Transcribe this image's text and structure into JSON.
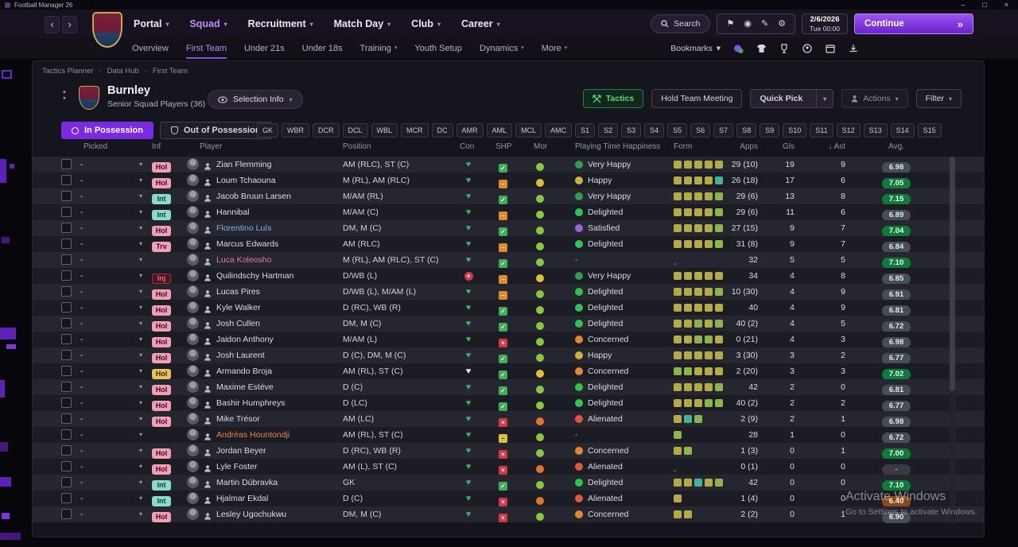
{
  "window": {
    "title": "Football Manager 26"
  },
  "icons": {
    "chevron_down": "▾",
    "back": "‹",
    "forward": "›",
    "continue_chevrons": "»",
    "sort_desc": "↓",
    "minimize": "–",
    "maximize": "□",
    "close": "×",
    "flag": "⚑",
    "pencil": "✎",
    "gear": "⚙",
    "ball": "◉",
    "collapse_up": "▴",
    "collapse_down": "▾",
    "heart": "♥",
    "check": "✓",
    "cross": "×",
    "dash": "–",
    "plus": "+"
  },
  "navbar": {
    "menus": [
      {
        "label": "Portal"
      },
      {
        "label": "Squad"
      },
      {
        "label": "Recruitment"
      },
      {
        "label": "Match Day"
      },
      {
        "label": "Club"
      },
      {
        "label": "Career"
      }
    ],
    "search_label": "Search",
    "date_line1": "2/6/2026",
    "date_line2": "Tue 00:00",
    "continue_label": "Continue"
  },
  "subnav": {
    "tabs": [
      "Overview",
      "First Team",
      "Under 21s",
      "Under 18s",
      "Training",
      "Youth Setup",
      "Dynamics",
      "More"
    ],
    "bookmarks_label": "Bookmarks"
  },
  "breadcrumb": [
    "Tactics Planner",
    "Data Hub",
    "First Team"
  ],
  "header": {
    "team": "Burnley",
    "subtitle": "Senior Squad Players (36)",
    "selection_info": "Selection Info",
    "buttons": {
      "tactics": "Tactics",
      "meeting": "Hold Team Meeting",
      "quick_pick": "Quick Pick",
      "actions": "Actions",
      "filter": "Filter"
    }
  },
  "toggles": {
    "in_possession": "In Possession",
    "out_possession": "Out of Possession"
  },
  "position_pills": [
    "GK",
    "WBR",
    "DCR",
    "DCL",
    "WBL",
    "MCR",
    "DC",
    "AMR",
    "AML",
    "MCL",
    "AMC",
    "S1",
    "S2",
    "S3",
    "S4",
    "S5",
    "S6",
    "S7",
    "S8",
    "S9",
    "S10",
    "S11",
    "S12",
    "S13",
    "S14",
    "S15"
  ],
  "table": {
    "picked_value": "-",
    "columns": {
      "picked": "Picked",
      "inf": "Inf",
      "player": "Player",
      "position": "Position",
      "con": "Con",
      "shp": "SHP",
      "mor": "Mor",
      "happiness": "Playing Time Happiness",
      "form": "Form",
      "apps": "Apps",
      "gls": "Gls",
      "ast": "Ast",
      "avg": "Avg."
    },
    "rows": [
      {
        "inf": {
          "label": "Hol",
          "type": "hol"
        },
        "name": "Zian Flemming",
        "pos": "AM (RLC), ST (C)",
        "con": "g",
        "shp": "check",
        "mor": "g",
        "hap": {
          "level": "very-happy",
          "label": "Very Happy"
        },
        "form": [
          "y",
          "y",
          "y",
          "y",
          "y"
        ],
        "apps": "29 (10)",
        "gls": "19",
        "ast": "9",
        "avg": {
          "v": "6.98",
          "c": "ok"
        }
      },
      {
        "inf": {
          "label": "Hol",
          "type": "hol"
        },
        "name": "Loum Tchaouna",
        "pos": "M (RL), AM (RLC)",
        "con": "g",
        "shp": "orange",
        "mor": "y",
        "hap": {
          "level": "happy",
          "label": "Happy"
        },
        "form": [
          "y",
          "y",
          "y",
          "y",
          "t"
        ],
        "apps": "26 (18)",
        "gls": "17",
        "ast": "6",
        "avg": {
          "v": "7.05",
          "c": "good"
        }
      },
      {
        "inf": {
          "label": "Int",
          "type": "int"
        },
        "name": "Jacob Bruun Larsen",
        "pos": "M/AM (RL)",
        "con": "g",
        "shp": "check",
        "mor": "g",
        "hap": {
          "level": "very-happy",
          "label": "Very Happy"
        },
        "form": [
          "y",
          "y",
          "y",
          "y",
          "g"
        ],
        "apps": "29 (6)",
        "gls": "13",
        "ast": "8",
        "avg": {
          "v": "7.15",
          "c": "good"
        }
      },
      {
        "inf": {
          "label": "Int",
          "type": "int"
        },
        "name": "Hannibal",
        "pos": "M/AM (C)",
        "con": "g",
        "shp": "orange",
        "mor": "g",
        "hap": {
          "level": "delighted",
          "label": "Delighted"
        },
        "form": [
          "y",
          "y",
          "y",
          "y",
          "g"
        ],
        "apps": "29 (6)",
        "gls": "11",
        "ast": "6",
        "avg": {
          "v": "6.89",
          "c": "ok"
        }
      },
      {
        "inf": {
          "label": "Hol",
          "type": "hol"
        },
        "name": "Florentino Luís",
        "name_color": "#7db4e8",
        "pos": "DM, M (C)",
        "con": "g",
        "shp": "check",
        "mor": "g",
        "hap": {
          "level": "satisfied",
          "label": "Satisfied"
        },
        "form": [
          "y",
          "y",
          "y",
          "y",
          "g"
        ],
        "apps": "27 (15)",
        "gls": "9",
        "ast": "7",
        "avg": {
          "v": "7.04",
          "c": "good"
        }
      },
      {
        "inf": {
          "label": "Trv",
          "type": "trv"
        },
        "name": "Marcus Edwards",
        "pos": "AM (RLC)",
        "con": "g",
        "shp": "orange",
        "mor": "g",
        "hap": {
          "level": "delighted",
          "label": "Delighted"
        },
        "form": [
          "y",
          "y",
          "y",
          "y",
          "g"
        ],
        "apps": "31 (8)",
        "gls": "9",
        "ast": "7",
        "avg": {
          "v": "6.84",
          "c": "ok"
        }
      },
      {
        "inf": null,
        "name": "Luca Koleosho",
        "name_color": "#e87a8e",
        "pos": "M (RL), AM (RLC), ST (C)",
        "con": "g",
        "shp": "check",
        "mor": "g",
        "hap": {
          "level": "none",
          "label": "-"
        },
        "form": [],
        "apps": "32",
        "gls": "5",
        "ast": "5",
        "avg": {
          "v": "7.10",
          "c": "good"
        }
      },
      {
        "inf": {
          "label": "Inj",
          "type": "inj"
        },
        "name": "Quilindschy Hartman",
        "pos": "D/WB (L)",
        "con": "plus",
        "shp": "orange",
        "mor": "y",
        "hap": {
          "level": "very-happy",
          "label": "Very Happy"
        },
        "form": [
          "y",
          "y",
          "y",
          "y",
          "y"
        ],
        "apps": "34",
        "gls": "4",
        "ast": "8",
        "avg": {
          "v": "6.85",
          "c": "ok"
        }
      },
      {
        "inf": {
          "label": "Hol",
          "type": "hol"
        },
        "name": "Lucas Pires",
        "pos": "D/WB (L), M/AM (L)",
        "con": "g",
        "shp": "orange",
        "mor": "g",
        "hap": {
          "level": "delighted",
          "label": "Delighted"
        },
        "form": [
          "y",
          "y",
          "y",
          "y",
          "g"
        ],
        "apps": "10 (30)",
        "gls": "4",
        "ast": "9",
        "avg": {
          "v": "6.91",
          "c": "ok"
        }
      },
      {
        "inf": {
          "label": "Hol",
          "type": "hol"
        },
        "name": "Kyle Walker",
        "pos": "D (RC), WB (R)",
        "con": "g",
        "shp": "check",
        "mor": "g",
        "hap": {
          "level": "delighted",
          "label": "Delighted"
        },
        "form": [
          "y",
          "y",
          "y",
          "y",
          "y"
        ],
        "apps": "40",
        "gls": "4",
        "ast": "9",
        "avg": {
          "v": "6.81",
          "c": "ok"
        }
      },
      {
        "inf": {
          "label": "Hol",
          "type": "hol"
        },
        "name": "Josh Cullen",
        "pos": "DM, M (C)",
        "con": "g",
        "shp": "check",
        "mor": "g",
        "hap": {
          "level": "delighted",
          "label": "Delighted"
        },
        "form": [
          "y",
          "y",
          "g",
          "y",
          "g"
        ],
        "apps": "40 (2)",
        "gls": "4",
        "ast": "5",
        "avg": {
          "v": "6.72",
          "c": "ok"
        }
      },
      {
        "inf": {
          "label": "Hol",
          "type": "hol"
        },
        "name": "Jaidon Anthony",
        "pos": "M/AM (L)",
        "con": "g",
        "shp": "x",
        "mor": "g",
        "hap": {
          "level": "concerned",
          "label": "Concerned"
        },
        "form": [
          "y",
          "y",
          "g",
          "g",
          "y"
        ],
        "apps": "0 (21)",
        "gls": "4",
        "ast": "3",
        "avg": {
          "v": "6.98",
          "c": "ok"
        }
      },
      {
        "inf": {
          "label": "Hol",
          "type": "hol"
        },
        "name": "Josh Laurent",
        "pos": "D (C), DM, M (C)",
        "con": "g",
        "shp": "check",
        "mor": "g",
        "hap": {
          "level": "happy",
          "label": "Happy"
        },
        "form": [
          "y",
          "y",
          "y",
          "y",
          "y"
        ],
        "apps": "3 (30)",
        "gls": "3",
        "ast": "2",
        "avg": {
          "v": "6.77",
          "c": "ok"
        }
      },
      {
        "inf": {
          "label": "Hol",
          "type": "hol2"
        },
        "name": "Armando Broja",
        "pos": "AM (RL), ST (C)",
        "con": "w",
        "shp": "check",
        "mor": "y",
        "hap": {
          "level": "concerned",
          "label": "Concerned"
        },
        "form": [
          "g",
          "g",
          "y",
          "y",
          "y"
        ],
        "apps": "2 (20)",
        "gls": "3",
        "ast": "3",
        "avg": {
          "v": "7.02",
          "c": "good"
        }
      },
      {
        "inf": {
          "label": "Hol",
          "type": "hol"
        },
        "name": "Maxime Estève",
        "pos": "D (C)",
        "con": "g",
        "shp": "check",
        "mor": "g",
        "hap": {
          "level": "delighted",
          "label": "Delighted"
        },
        "form": [
          "y",
          "y",
          "y",
          "y",
          "g"
        ],
        "apps": "42",
        "gls": "2",
        "ast": "0",
        "avg": {
          "v": "6.81",
          "c": "ok"
        }
      },
      {
        "inf": {
          "label": "Hol",
          "type": "hol"
        },
        "name": "Bashir Humphreys",
        "pos": "D (LC)",
        "con": "g",
        "shp": "check",
        "mor": "g",
        "hap": {
          "level": "delighted",
          "label": "Delighted"
        },
        "form": [
          "y",
          "y",
          "y",
          "g",
          "g"
        ],
        "apps": "40 (2)",
        "gls": "2",
        "ast": "2",
        "avg": {
          "v": "6.77",
          "c": "ok"
        }
      },
      {
        "inf": {
          "label": "Hol",
          "type": "hol"
        },
        "name": "Mike Trésor",
        "pos": "AM (LC)",
        "con": "g",
        "shp": "x",
        "mor": "o",
        "hap": {
          "level": "alienated",
          "label": "Alienated"
        },
        "form": [
          "y",
          "t",
          "g"
        ],
        "apps": "2 (9)",
        "gls": "2",
        "ast": "1",
        "avg": {
          "v": "6.98",
          "c": "ok"
        }
      },
      {
        "inf": null,
        "name": "Andréas Hountondji",
        "name_color": "#e8854a",
        "pos": "AM (RL), ST (C)",
        "con": "g",
        "shp": "dash",
        "mor": "g",
        "hap": {
          "level": "none",
          "label": "-"
        },
        "form": [
          "g"
        ],
        "apps": "28",
        "gls": "1",
        "ast": "0",
        "avg": {
          "v": "6.72",
          "c": "ok"
        }
      },
      {
        "inf": {
          "label": "Hol",
          "type": "hol"
        },
        "name": "Jordan Beyer",
        "pos": "D (RC), WB (R)",
        "con": "g",
        "shp": "x",
        "mor": "g",
        "hap": {
          "level": "concerned",
          "label": "Concerned"
        },
        "form": [
          "y",
          "g"
        ],
        "apps": "1 (3)",
        "gls": "0",
        "ast": "1",
        "avg": {
          "v": "7.00",
          "c": "good"
        }
      },
      {
        "inf": {
          "label": "Hol",
          "type": "hol"
        },
        "name": "Lyle Foster",
        "pos": "AM (L), ST (C)",
        "con": "g",
        "shp": "x",
        "mor": "o",
        "hap": {
          "level": "alienated",
          "label": "Alienated"
        },
        "form": [],
        "apps": "0 (1)",
        "gls": "0",
        "ast": "0",
        "avg": {
          "v": "-",
          "c": "none"
        }
      },
      {
        "inf": {
          "label": "Int",
          "type": "int"
        },
        "name": "Martin Dúbravka",
        "pos": "GK",
        "con": "g",
        "shp": "check",
        "mor": "g",
        "hap": {
          "level": "delighted",
          "label": "Delighted"
        },
        "form": [
          "y",
          "y",
          "t",
          "y",
          "g"
        ],
        "apps": "42",
        "gls": "0",
        "ast": "0",
        "avg": {
          "v": "7.10",
          "c": "good"
        }
      },
      {
        "inf": {
          "label": "Int",
          "type": "int"
        },
        "name": "Hjalmar Ekdal",
        "pos": "D (C)",
        "con": "g",
        "shp": "x",
        "mor": "o",
        "hap": {
          "level": "alienated",
          "label": "Alienated"
        },
        "form": [
          "y"
        ],
        "apps": "1 (4)",
        "gls": "0",
        "ast": "0",
        "avg": {
          "v": "6.40",
          "c": "poor"
        }
      },
      {
        "inf": {
          "label": "Hol",
          "type": "hol"
        },
        "name": "Lesley Ugochukwu",
        "pos": "DM, M (C)",
        "con": "g",
        "shp": "x",
        "mor": "g",
        "hap": {
          "level": "concerned",
          "label": "Concerned"
        },
        "form": [
          "y",
          "y"
        ],
        "apps": "2 (2)",
        "gls": "0",
        "ast": "1",
        "avg": {
          "v": "6.90",
          "c": "ok"
        }
      }
    ]
  },
  "watermark": {
    "line1": "Activate Windows",
    "line2": "Go to Settings to activate Windows."
  }
}
